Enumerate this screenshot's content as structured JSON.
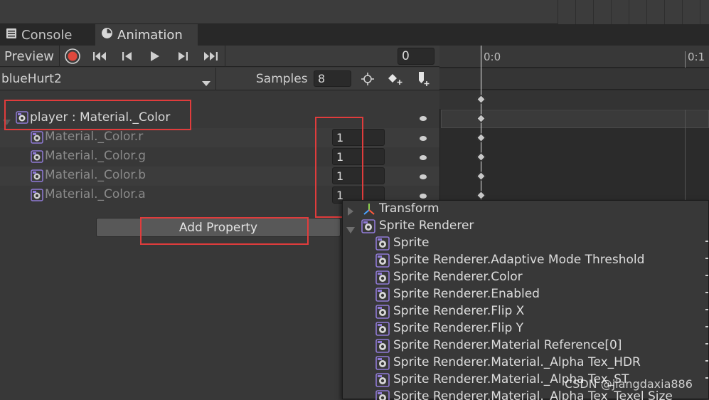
{
  "tabs": [
    {
      "label": "Console",
      "icon": "console-icon"
    },
    {
      "label": "Animation",
      "icon": "animation-clock-icon"
    }
  ],
  "toolbar": {
    "preview_label": "Preview",
    "frame_value": "0"
  },
  "clip": {
    "name": "blueHurt2",
    "samples_label": "Samples",
    "samples_value": "8"
  },
  "timeline": {
    "tick_0": "0:0",
    "tick_1": "0:1"
  },
  "properties": {
    "group_label": "player : Material._Color",
    "items": [
      {
        "label": "Material._Color.r",
        "value": "1"
      },
      {
        "label": "Material._Color.g",
        "value": "1"
      },
      {
        "label": "Material._Color.b",
        "value": "1"
      },
      {
        "label": "Material._Color.a",
        "value": "1"
      }
    ],
    "add_property_label": "Add Property"
  },
  "popup": {
    "items": [
      {
        "label": "Transform",
        "expanded": false,
        "group": true
      },
      {
        "label": "Sprite Renderer",
        "expanded": true,
        "group": true
      },
      {
        "label": "Sprite"
      },
      {
        "label": "Sprite Renderer.Adaptive Mode Threshold"
      },
      {
        "label": "Sprite Renderer.Color"
      },
      {
        "label": "Sprite Renderer.Enabled"
      },
      {
        "label": "Sprite Renderer.Flip X"
      },
      {
        "label": "Sprite Renderer.Flip Y"
      },
      {
        "label": "Sprite Renderer.Material Reference[0]"
      },
      {
        "label": "Sprite Renderer.Material._Alpha Tex_HDR"
      },
      {
        "label": "Sprite Renderer.Material._Alpha Tex_ST"
      },
      {
        "label": "Sprite Renderer.Material._Alpha Tex_Texel Size"
      }
    ]
  },
  "watermark": "CSDN @jiangdaxia886",
  "colors": {
    "highlight_red": "#e03c3c",
    "record_red": "#e0483c"
  }
}
